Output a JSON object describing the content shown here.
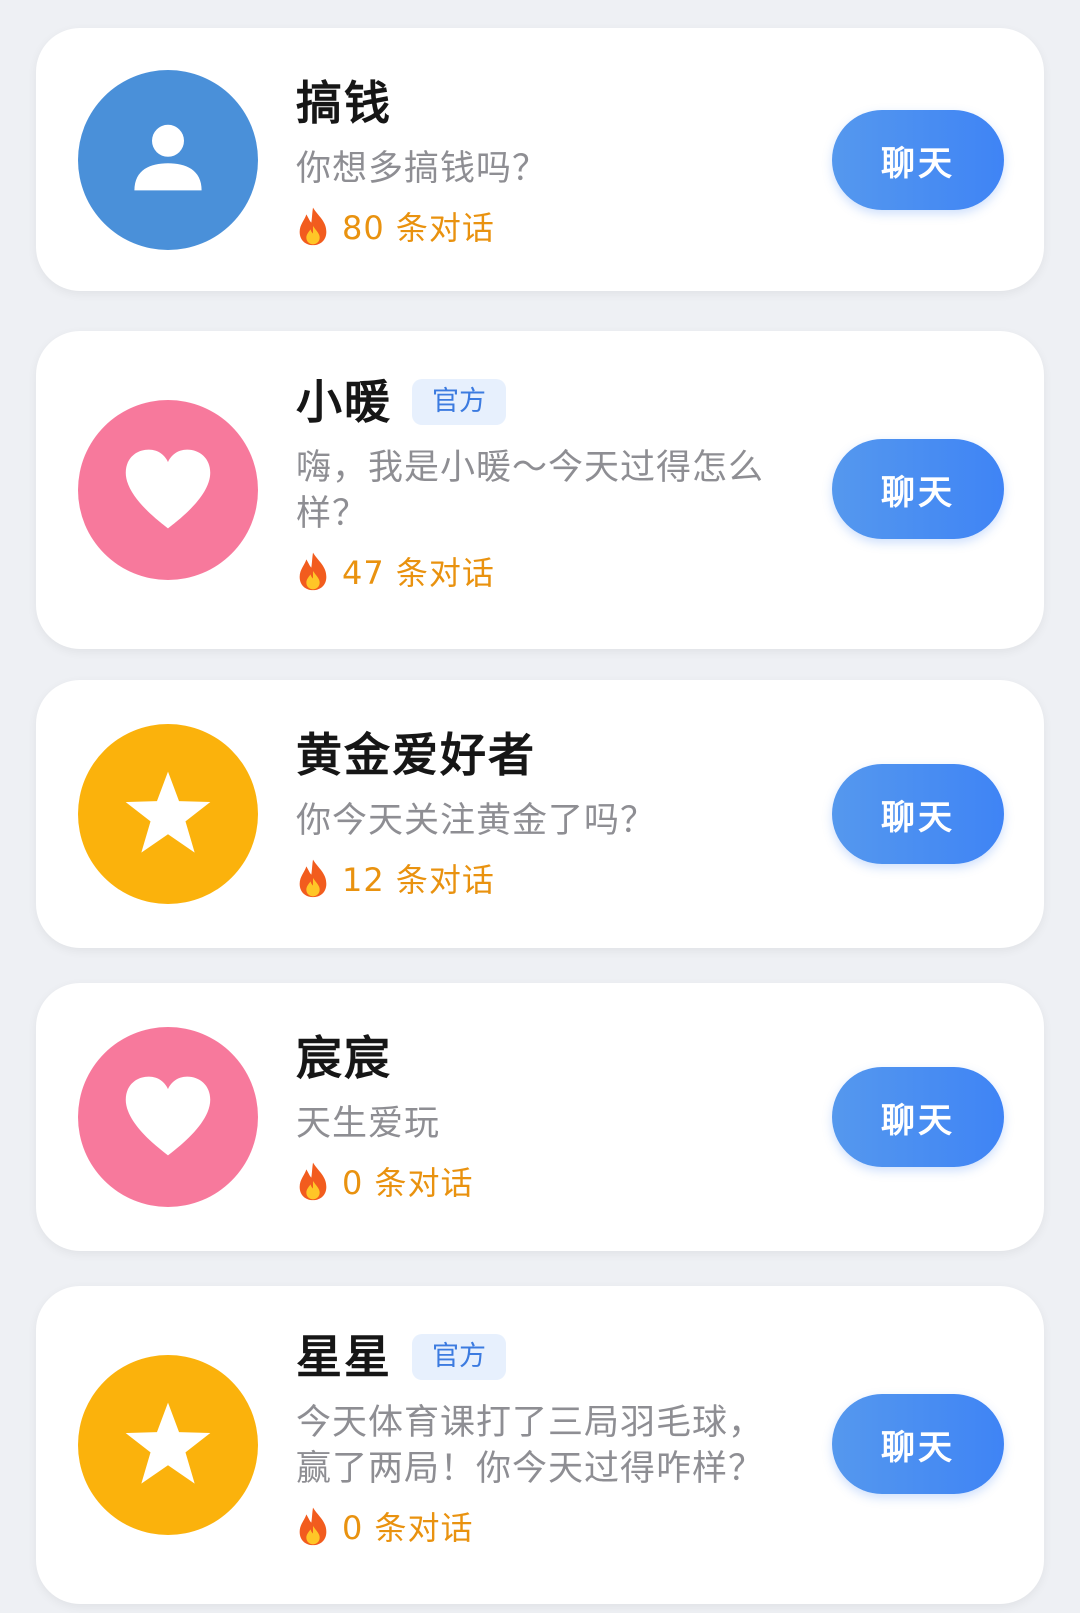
{
  "cards": [
    {
      "name": "搞钱",
      "badge": "",
      "description": "你想多搞钱吗？",
      "conversations": "80 条对话",
      "button": "聊天",
      "avatar_icon": "person-icon",
      "avatar_color": "#4a90d9"
    },
    {
      "name": "小暖",
      "badge": "官方",
      "description": "嗨，我是小暖～今天过得怎么样？",
      "conversations": "47 条对话",
      "button": "聊天",
      "avatar_icon": "heart-icon",
      "avatar_color": "#f7799c"
    },
    {
      "name": "黄金爱好者",
      "badge": "",
      "description": "你今天关注黄金了吗？",
      "conversations": "12 条对话",
      "button": "聊天",
      "avatar_icon": "star-icon",
      "avatar_color": "#fbb20c"
    },
    {
      "name": "宸宸",
      "badge": "",
      "description": "天生爱玩",
      "conversations": "0 条对话",
      "button": "聊天",
      "avatar_icon": "heart-icon",
      "avatar_color": "#f7799c"
    },
    {
      "name": "星星",
      "badge": "官方",
      "description": "今天体育课打了三局羽毛球，赢了两局！你今天过得咋样？",
      "conversations": "0 条对话",
      "button": "聊天",
      "avatar_icon": "star-icon",
      "avatar_color": "#fbb20c"
    }
  ],
  "colors": {
    "background": "#eef0f4",
    "button": "#4a8ef2",
    "count": "#e9920f",
    "badge_bg": "#e7f0fd",
    "badge_text": "#3c7be0"
  }
}
